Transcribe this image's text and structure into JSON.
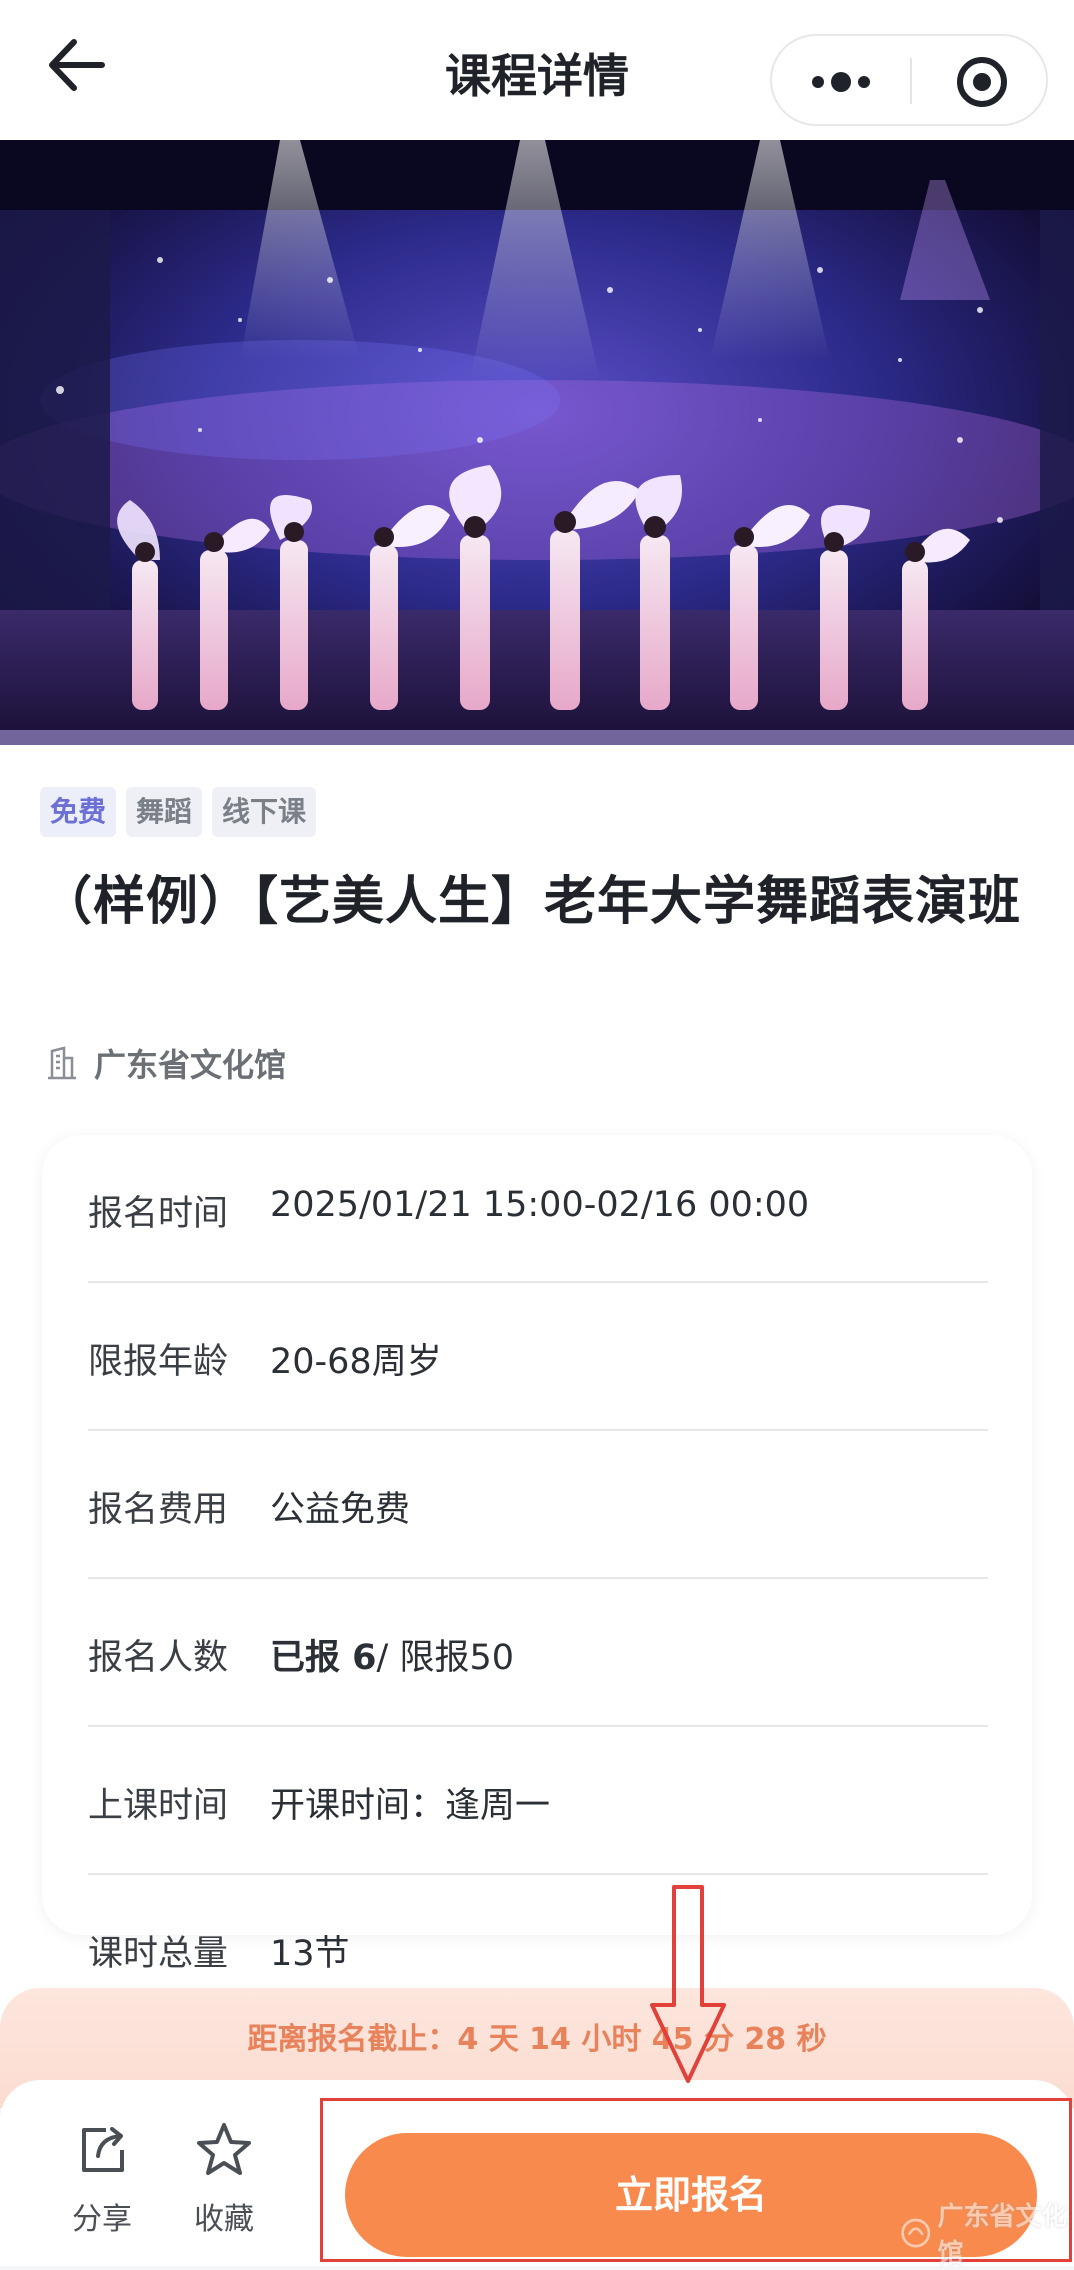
{
  "header": {
    "title": "课程详情"
  },
  "tags": [
    "免费",
    "舞蹈",
    "线下课"
  ],
  "course": {
    "title": "（样例）【艺美人生】老年大学舞蹈表演班",
    "organizer": "广东省文化馆"
  },
  "info": [
    {
      "label": "报名时间",
      "value": "2025/01/21 15:00-02/16 00:00"
    },
    {
      "label": "限报年龄",
      "value": "20-68周岁"
    },
    {
      "label": "报名费用",
      "value": "公益免费"
    },
    {
      "label": "报名人数",
      "value_bold": "已报 6",
      "value": "/ 限报50"
    },
    {
      "label": "上课时间",
      "value": "开课时间：逢周一"
    },
    {
      "label": "课时总量",
      "value": "13节"
    }
  ],
  "countdown": {
    "text": "距离报名截止：4 天 14 小时 45 分 28 秒"
  },
  "bottom_bar": {
    "share_label": "分享",
    "favorite_label": "收藏",
    "signup_label": "立即报名"
  },
  "watermark": {
    "text": "广东省文化馆"
  },
  "colors": {
    "accent": "#f98a4d",
    "countdown_text": "#e8825a",
    "annotation": "#e2403a",
    "free_tag": "#6c6fd4"
  }
}
